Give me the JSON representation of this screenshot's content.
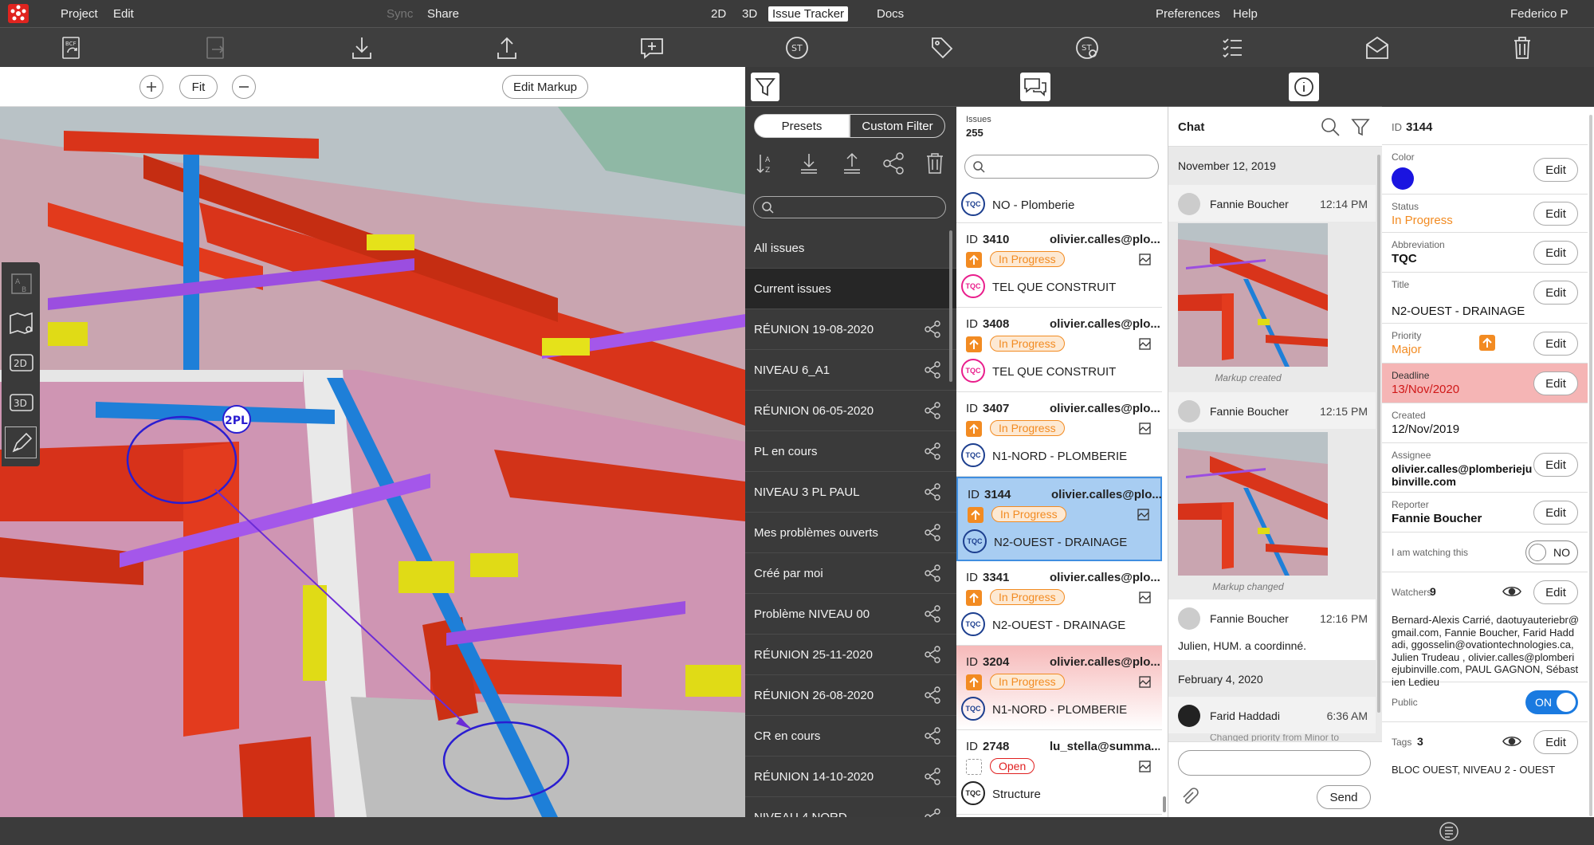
{
  "menubar": {
    "project": "Project",
    "edit": "Edit",
    "sync": "Sync",
    "share": "Share",
    "tab_2d": "2D",
    "tab_3d": "3D",
    "tab_issue": "Issue Tracker",
    "docs": "Docs",
    "preferences": "Preferences",
    "help": "Help",
    "user": "Federico P"
  },
  "viewer": {
    "fit_label": "Fit",
    "edit_markup_label": "Edit Markup",
    "markup_tag": "2PL"
  },
  "lefttools": [
    "A/B",
    "map",
    "2D",
    "3D",
    "pen"
  ],
  "filters": {
    "presets_label": "Presets",
    "custom_label": "Custom Filter",
    "items": [
      "All issues",
      "Current issues",
      "RÉUNION 19-08-2020",
      "NIVEAU 6_A1",
      "RÉUNION 06-05-2020",
      "PL en cours",
      "NIVEAU 3 PL PAUL",
      "Mes problèmes ouverts",
      "Créé par moi",
      "Problème NIVEAU 00",
      "RÉUNION 25-11-2020",
      "RÉUNION 26-08-2020",
      "CR en cours",
      "RÉUNION 14-10-2020",
      "NIVEAU 4 NORD"
    ]
  },
  "issues": {
    "header_label": "Issues",
    "count": "255",
    "first_tag_label": "NO - Plomberie",
    "id_prefix": "ID",
    "list": [
      {
        "id": "3410",
        "who": "olivier.calles@plo...",
        "status": "In Progress",
        "title": "TEL QUE CONSTRUIT"
      },
      {
        "id": "3408",
        "who": "olivier.calles@plo...",
        "status": "In Progress",
        "title": "TEL QUE CONSTRUIT"
      },
      {
        "id": "3407",
        "who": "olivier.calles@plo...",
        "status": "In Progress",
        "title": "N1-NORD - PLOMBERIE"
      },
      {
        "id": "3144",
        "who": "olivier.calles@plo...",
        "status": "In Progress",
        "title": "N2-OUEST - DRAINAGE"
      },
      {
        "id": "3341",
        "who": "olivier.calles@plo...",
        "status": "In Progress",
        "title": "N2-OUEST - DRAINAGE"
      },
      {
        "id": "3204",
        "who": "olivier.calles@plo...",
        "status": "In Progress",
        "title": "N1-NORD - PLOMBERIE"
      },
      {
        "id": "2748",
        "who": "lu_stella@summa...",
        "status": "Open",
        "title": "Structure"
      }
    ],
    "tag_abbr": "TQC"
  },
  "chat": {
    "title": "Chat",
    "date1": "November 12, 2019",
    "m1_name": "Fannie Boucher",
    "m1_time": "12:14 PM",
    "m1_caption": "Markup created",
    "m2_name": "Fannie Boucher",
    "m2_time": "12:15 PM",
    "m2_caption": "Markup changed",
    "m3_name": "Fannie Boucher",
    "m3_time": "12:16 PM",
    "m3_text": "Julien, HUM. a coordinné.",
    "date2": "February 4, 2020",
    "m4_name": "Farid Haddadi",
    "m4_time": "6:36 AM",
    "m4_text": "Changed priority from Minor to",
    "send_label": "Send"
  },
  "detail": {
    "id_label": "ID",
    "id_value": "3144",
    "color_label": "Color",
    "color_value": "#1a14e0",
    "status_label": "Status",
    "status_value": "In Progress",
    "abbr_label": "Abbreviation",
    "abbr_value": "TQC",
    "title_label": "Title",
    "title_value": "N2-OUEST - DRAINAGE",
    "priority_label": "Priority",
    "priority_value": "Major",
    "deadline_label": "Deadline",
    "deadline_value": "13/Nov/2020",
    "created_label": "Created",
    "created_value": "12/Nov/2019",
    "assignee_label": "Assignee",
    "assignee_value": "olivier.calles@plomberiejubinville.com",
    "reporter_label": "Reporter",
    "reporter_value": "Fannie Boucher",
    "watching_label": "I am watching this",
    "watching_value": "NO",
    "watchers_label": "Watchers",
    "watchers_count": "9",
    "watchers_list": "Bernard-Alexis Carrié, daotuyauteriebr@gmail.com, Fannie Boucher, Farid Haddadi, ggosselin@ovationtechnologies.ca, Julien Trudeau , olivier.calles@plomberiejubinville.com, PAUL GAGNON, Sébastien Ledieu",
    "public_label": "Public",
    "public_value": "ON",
    "tags_label": "Tags",
    "tags_count": "3",
    "tags_value": "BLOC OUEST, NIVEAU 2 - OUEST",
    "edit_label": "Edit"
  }
}
